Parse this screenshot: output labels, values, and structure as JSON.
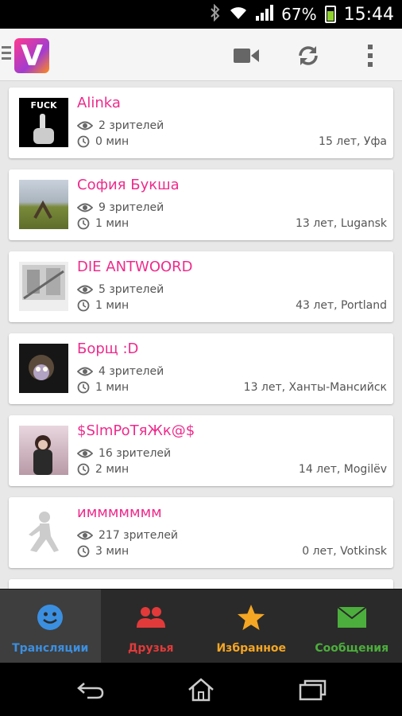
{
  "status_bar": {
    "icons": [
      "bluetooth-icon",
      "wifi-icon",
      "signal-icon",
      "battery-icon"
    ],
    "battery_percent": "67%",
    "time": "15:44"
  },
  "app_bar": {
    "logo_letter": "V",
    "actions": [
      "video-camera-icon",
      "refresh-icon",
      "more-vert-icon"
    ]
  },
  "streams": [
    {
      "name": "Alinka",
      "viewers": "2 зрителей",
      "duration": "0 мин",
      "meta": "15 лет, Уфа",
      "thumb_text": "FUCK"
    },
    {
      "name": "София Букша",
      "viewers": "9 зрителей",
      "duration": "1 мин",
      "meta": "13 лет, Lugansk"
    },
    {
      "name": "DIE ANTWOORD",
      "viewers": "5 зрителей",
      "duration": "1 мин",
      "meta": "43 лет, Portland"
    },
    {
      "name": "Борщ :D",
      "viewers": "4 зрителей",
      "duration": "1 мин",
      "meta": "13 лет, Ханты-Мансийск"
    },
    {
      "name": "$SlmPoTяЖк@$",
      "viewers": "16 зрителей",
      "duration": "2 мин",
      "meta": "14 лет, Mogilёv"
    },
    {
      "name": "иммммммм",
      "viewers": "217 зрителей",
      "duration": "3 мин",
      "meta": "0 лет, Votkinsk"
    }
  ],
  "bottom_tabs": [
    {
      "label": "Трансляции",
      "icon": "smiley-icon",
      "color": "#3b8fe0",
      "active": true
    },
    {
      "label": "Друзья",
      "icon": "friends-icon",
      "color": "#e23a3a",
      "active": false
    },
    {
      "label": "Избранное",
      "icon": "star-icon",
      "color": "#f5a623",
      "active": false
    },
    {
      "label": "Сообщения",
      "icon": "envelope-icon",
      "color": "#4cae3c",
      "active": false
    }
  ],
  "nav_bar": [
    "back-icon",
    "home-icon",
    "recent-apps-icon"
  ],
  "colors": {
    "accent": "#ee2b8c",
    "meta_text": "#555555"
  }
}
